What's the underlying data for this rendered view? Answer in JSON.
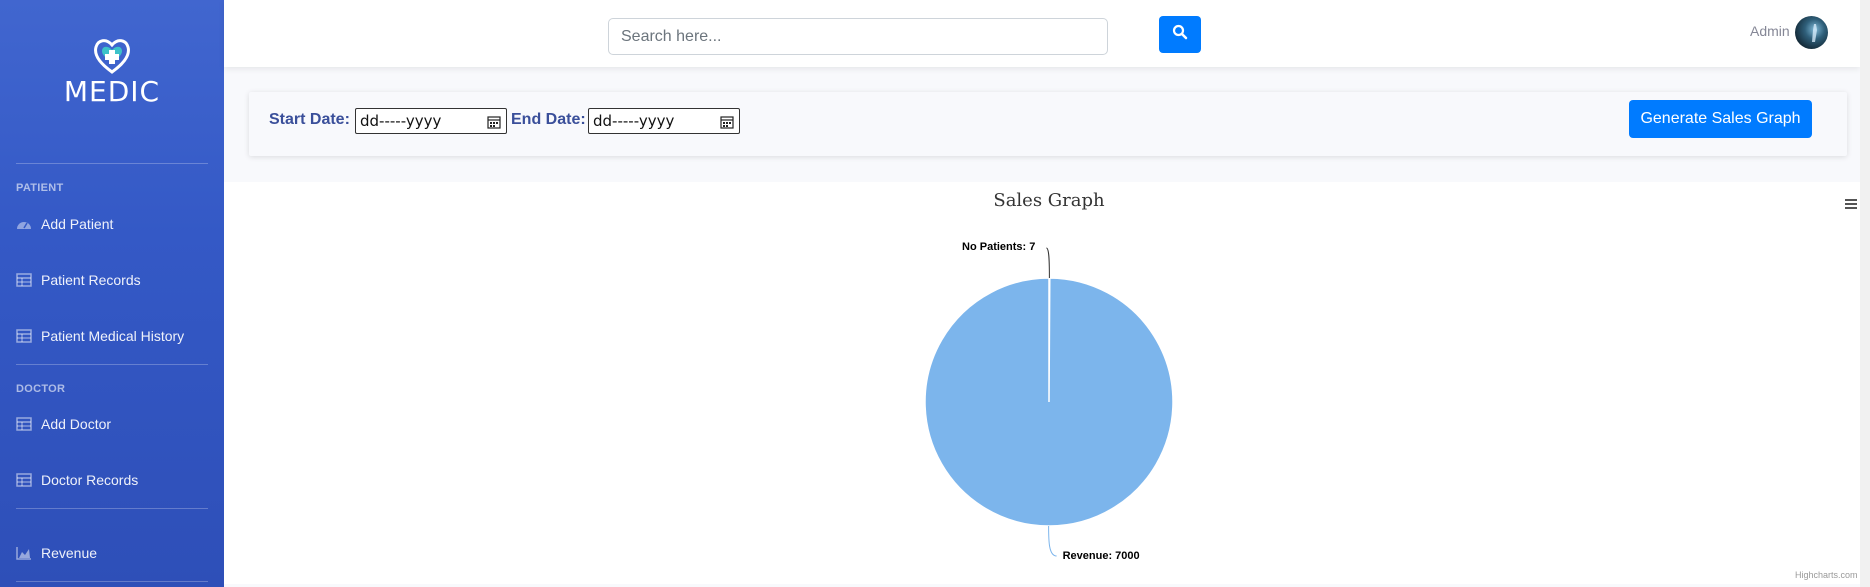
{
  "sidebar": {
    "brand": "MEDIC",
    "sections": [
      {
        "heading": "PATIENT",
        "items": [
          {
            "label": "Add Patient",
            "icon": "dashboard-gauge-icon"
          },
          {
            "label": "Patient Records",
            "icon": "table-icon"
          },
          {
            "label": "Patient Medical History",
            "icon": "table-icon"
          }
        ]
      },
      {
        "heading": "DOCTOR",
        "items": [
          {
            "label": "Add Doctor",
            "icon": "table-icon"
          },
          {
            "label": "Doctor Records",
            "icon": "table-icon"
          }
        ]
      }
    ],
    "extra_item": {
      "label": "Revenue",
      "icon": "area-chart-icon"
    }
  },
  "topbar": {
    "search_placeholder": "Search here...",
    "search_icon": "search-icon",
    "user_name": "Admin"
  },
  "filter": {
    "start_label": "Start Date:",
    "start_value": "dd-----yyyy",
    "end_label": "End Date:",
    "end_value": "dd-----yyyy",
    "generate_label": "Generate Sales Graph"
  },
  "chart_data": {
    "type": "pie",
    "title": "Sales Graph",
    "series": [
      {
        "name": "No Patients",
        "value": 7
      },
      {
        "name": "Revenue",
        "value": 7000
      }
    ],
    "labels": [
      "No Patients: 7",
      "Revenue: 7000"
    ],
    "color": "#7cb5ec",
    "credit": "Highcharts.com"
  },
  "colors": {
    "sidebar": "#3459c6",
    "accent": "#007bff",
    "pie": "#7cb5ec"
  }
}
